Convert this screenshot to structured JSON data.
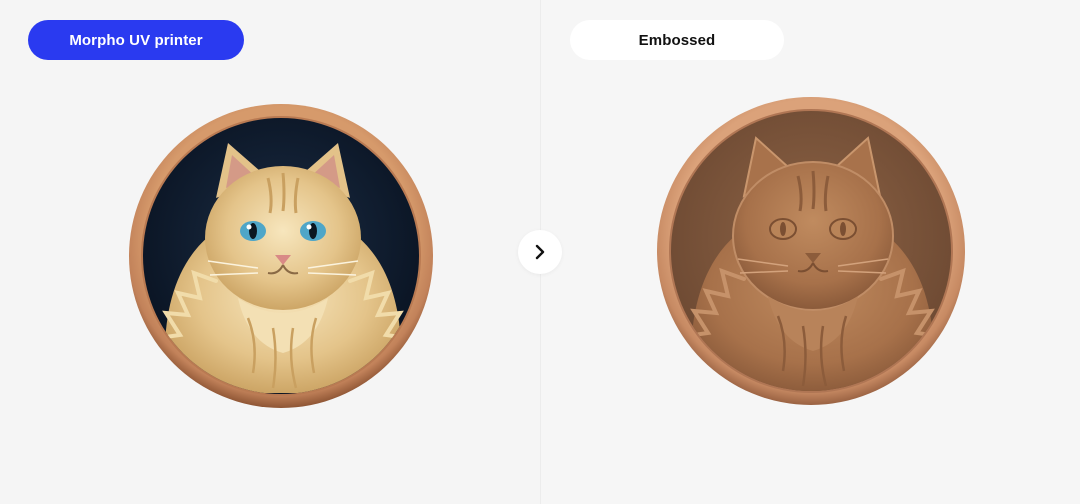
{
  "left_panel": {
    "label": "Morpho UV printer",
    "label_bg": "#2a3af0",
    "image": "color-cat-medallion"
  },
  "right_panel": {
    "label": "Embossed",
    "label_bg": "#ffffff",
    "image": "embossed-cat-medallion"
  },
  "navigation": {
    "icon": "chevron-right-icon"
  },
  "colors": {
    "frame": "#c98a5e",
    "frame_dark": "#a8683f",
    "color_bg": "#0f1b2c",
    "fur": "#e7c98f",
    "embossed": "#a7714a"
  }
}
